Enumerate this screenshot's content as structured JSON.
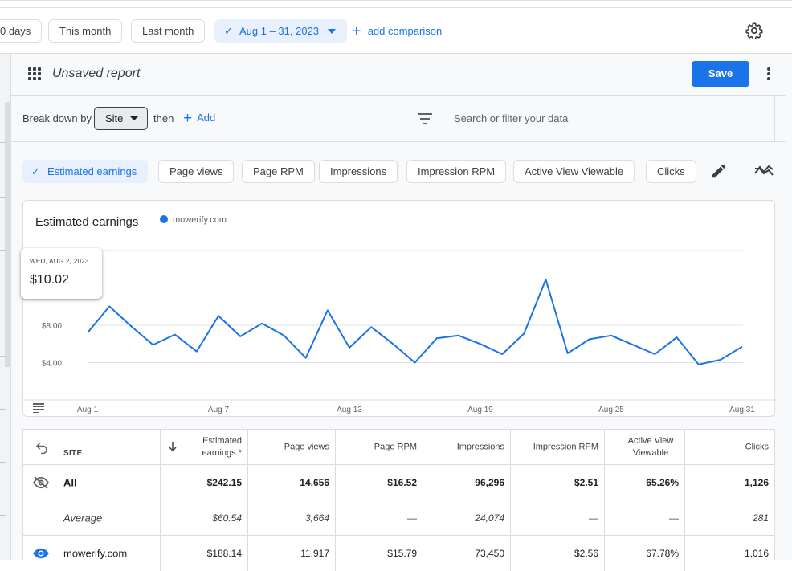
{
  "date_bar": {
    "chips": [
      "0 days",
      "This month",
      "Last month"
    ],
    "active_range": "Aug 1 – 31, 2023",
    "add_comparison": "add comparison"
  },
  "report": {
    "title": "Unsaved report",
    "save_label": "Save",
    "break_down_label": "Break down by",
    "break_down_value": "Site",
    "then_label": "then",
    "add_label": "Add",
    "search_placeholder": "Search or filter your data"
  },
  "metrics": [
    "Estimated earnings",
    "Page views",
    "Page RPM",
    "Impressions",
    "Impression RPM",
    "Active View Viewable",
    "Clicks"
  ],
  "chart": {
    "tooltip_date": "WED, AUG 2, 2023",
    "tooltip_value": "$10.02"
  },
  "chart_data": {
    "type": "line",
    "title": "Estimated earnings",
    "series": [
      {
        "name": "mowerify.com",
        "color": "#1a73e8",
        "x": [
          1,
          2,
          3,
          4,
          5,
          6,
          7,
          8,
          9,
          10,
          11,
          12,
          13,
          14,
          15,
          16,
          17,
          18,
          19,
          20,
          21,
          22,
          23,
          24,
          25,
          26,
          27,
          28,
          29,
          30,
          31
        ],
        "values": [
          7.2,
          10.02,
          7.9,
          5.9,
          7.0,
          5.2,
          9.0,
          6.8,
          8.2,
          6.9,
          4.5,
          9.6,
          5.6,
          7.8,
          6.0,
          4.0,
          6.6,
          6.9,
          6.0,
          4.9,
          7.1,
          12.9,
          5.0,
          6.5,
          6.9,
          5.9,
          4.9,
          6.7,
          3.8,
          4.3,
          5.7
        ]
      }
    ],
    "yticks": [
      "$4.00",
      "$8.00"
    ],
    "xticks": [
      "Aug 1",
      "Aug 7",
      "Aug 13",
      "Aug 19",
      "Aug 25",
      "Aug 31"
    ],
    "xtick_days": [
      1,
      7,
      13,
      19,
      25,
      31
    ],
    "ylim": [
      0,
      16
    ]
  },
  "table": {
    "site_header": "SITE",
    "headers": [
      "Estimated earnings *",
      "Page views",
      "Page RPM",
      "Impressions",
      "Impression RPM",
      "Active View Viewable",
      "Clicks"
    ],
    "rows": [
      {
        "label": "All",
        "values": [
          "$242.15",
          "14,656",
          "$16.52",
          "96,296",
          "$2.51",
          "65.26%",
          "1,126"
        ]
      },
      {
        "label": "Average",
        "values": [
          "$60.54",
          "3,664",
          "—",
          "24,074",
          "—",
          "—",
          "281"
        ]
      },
      {
        "label": "mowerify.com",
        "values": [
          "$188.14",
          "11,917",
          "$15.79",
          "73,450",
          "$2.56",
          "67.78%",
          "1,016"
        ]
      }
    ]
  }
}
